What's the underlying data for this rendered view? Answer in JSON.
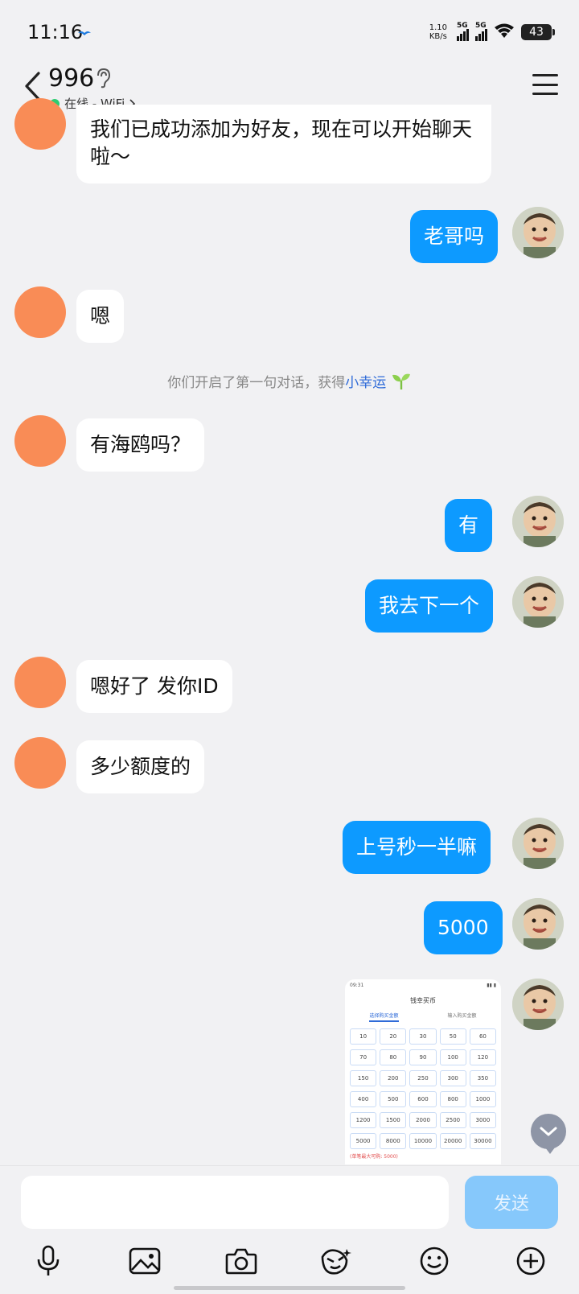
{
  "status_bar": {
    "time": "11:16",
    "net_speed_value": "1.10",
    "net_speed_unit": "KB/s",
    "sim1": "5G",
    "sim2": "5G",
    "battery": "43"
  },
  "header": {
    "contact_name": "996",
    "presence": "在线 - WiFi",
    "presence_color": "#2ecc71"
  },
  "colors": {
    "outgoing_bubble": "#0d9aff",
    "incoming_bubble": "#ffffff",
    "avatar_orange": "#f98c56",
    "background": "#f1f1f3"
  },
  "messages": [
    {
      "from": "them",
      "text": "我们已成功添加为好友，现在可以开始聊天啦～"
    },
    {
      "from": "me",
      "text": "老哥吗"
    },
    {
      "from": "them",
      "text": "嗯"
    },
    {
      "from": "me",
      "text": "有"
    },
    {
      "from": "me",
      "text": "我去下一个"
    },
    {
      "from": "them",
      "text": "嗯好了 发你ID"
    },
    {
      "from": "them",
      "text": "多少额度的"
    },
    {
      "from": "me",
      "text": "上号秒一半嘛"
    },
    {
      "from": "me",
      "text": "5000"
    }
  ],
  "system_note": {
    "text": "你们开启了第一句对话，获得",
    "highlight": "小幸运"
  },
  "messages_part2": {
    "them_1": "有海鸥吗？"
  },
  "image_message": {
    "header_time": "09:31",
    "title": "钱幸买币",
    "tab_active": "选择购买金额",
    "tab_other": "输入购买金额",
    "amounts": [
      "10",
      "20",
      "30",
      "50",
      "60",
      "70",
      "80",
      "90",
      "100",
      "120",
      "150",
      "200",
      "250",
      "300",
      "350",
      "400",
      "500",
      "600",
      "800",
      "1000",
      "1200",
      "1500",
      "2000",
      "2500",
      "3000",
      "5000",
      "8000",
      "10000",
      "20000",
      "30000"
    ],
    "footer": "(单笔最大可购: 5000)"
  },
  "input": {
    "placeholder": "",
    "send_label": "发送"
  },
  "toolbar": {
    "items": [
      "microphone-icon",
      "image-icon",
      "camera-icon",
      "sticker-icon",
      "emoji-icon",
      "plus-icon"
    ]
  }
}
